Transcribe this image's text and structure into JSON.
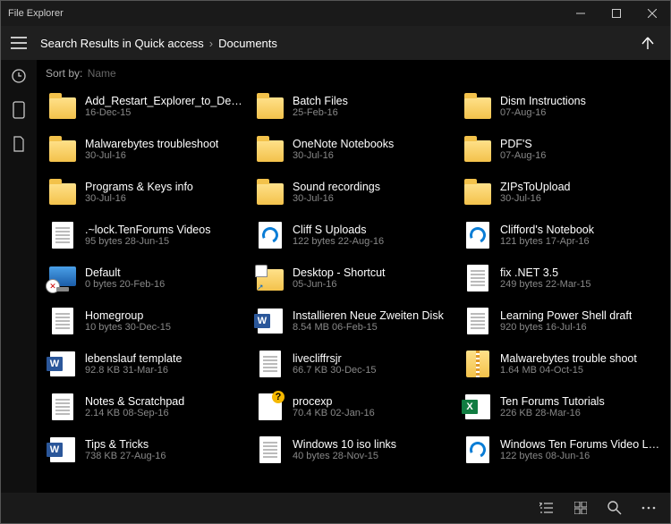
{
  "titlebar": {
    "title": "File Explorer"
  },
  "breadcrumb": {
    "prefix": "Search Results in Quick access",
    "current": "Documents"
  },
  "sort": {
    "label": "Sort by:",
    "value": "Name"
  },
  "items": [
    {
      "name": "Add_Restart_Explorer_to_Desktop",
      "meta": "16-Dec-15",
      "icon": "folder"
    },
    {
      "name": "Batch Files",
      "meta": "25-Feb-16",
      "icon": "folder"
    },
    {
      "name": "Dism Instructions",
      "meta": "07-Aug-16",
      "icon": "folder"
    },
    {
      "name": "Malwarebytes troubleshoot",
      "meta": "30-Jul-16",
      "icon": "folder"
    },
    {
      "name": "OneNote Notebooks",
      "meta": "30-Jul-16",
      "icon": "folder"
    },
    {
      "name": "PDF'S",
      "meta": "07-Aug-16",
      "icon": "folder"
    },
    {
      "name": "Programs & Keys info",
      "meta": "30-Jul-16",
      "icon": "folder"
    },
    {
      "name": "Sound recordings",
      "meta": "30-Jul-16",
      "icon": "folder"
    },
    {
      "name": "ZIPsToUpload",
      "meta": "30-Jul-16",
      "icon": "folder"
    },
    {
      "name": ".~lock.TenForums Videos",
      "meta": "95 bytes 28-Jun-15",
      "icon": "doc"
    },
    {
      "name": "Cliff S Uploads",
      "meta": "122 bytes 22-Aug-16",
      "icon": "edge"
    },
    {
      "name": "Clifford's Notebook",
      "meta": "121 bytes 17-Apr-16",
      "icon": "edge"
    },
    {
      "name": "Default",
      "meta": "0 bytes 20-Feb-16",
      "icon": "computer"
    },
    {
      "name": "Desktop - Shortcut",
      "meta": "05-Jun-16",
      "icon": "folder-shortcut"
    },
    {
      "name": "fix .NET 3.5",
      "meta": "249 bytes 22-Mar-15",
      "icon": "doc"
    },
    {
      "name": "Homegroup",
      "meta": "10 bytes 30-Dec-15",
      "icon": "doc"
    },
    {
      "name": "Installieren Neue Zweiten Disk",
      "meta": "8.54 MB 06-Feb-15",
      "icon": "word"
    },
    {
      "name": "Learning Power Shell draft",
      "meta": "920 bytes 16-Jul-16",
      "icon": "doc"
    },
    {
      "name": "lebenslauf template",
      "meta": "92.8 KB 31-Mar-16",
      "icon": "word"
    },
    {
      "name": "livecliffrsjr",
      "meta": "66.7 KB 30-Dec-15",
      "icon": "doc"
    },
    {
      "name": "Malwarebytes trouble shoot",
      "meta": "1.64 MB 04-Oct-15",
      "icon": "zip"
    },
    {
      "name": "Notes & Scratchpad",
      "meta": "2.14 KB 08-Sep-16",
      "icon": "doc"
    },
    {
      "name": "procexp",
      "meta": "70.4 KB 02-Jan-16",
      "icon": "help"
    },
    {
      "name": "Ten Forums Tutorials",
      "meta": "226 KB 28-Mar-16",
      "icon": "excel"
    },
    {
      "name": "Tips & Tricks",
      "meta": "738 KB 27-Aug-16",
      "icon": "word"
    },
    {
      "name": "Windows 10 iso links",
      "meta": "40 bytes 28-Nov-15",
      "icon": "doc"
    },
    {
      "name": "Windows Ten Forums Video Listing",
      "meta": "122 bytes 08-Jun-16",
      "icon": "edge"
    }
  ]
}
